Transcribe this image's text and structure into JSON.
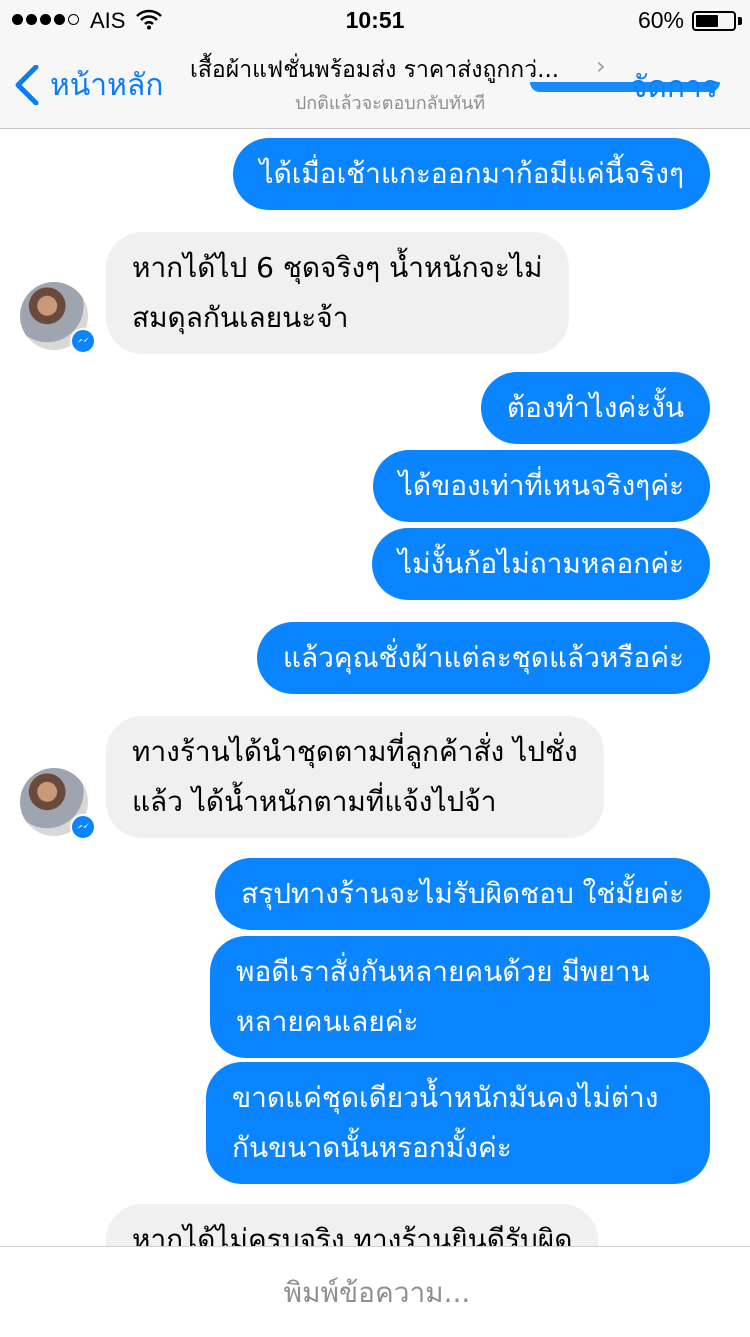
{
  "status_bar": {
    "carrier": "AIS",
    "time": "10:51",
    "battery_percent_label": "60%",
    "battery_level": 0.6
  },
  "nav": {
    "back_label": "หน้าหลัก",
    "title": "เสื้อผ้าแฟชั่นพร้อมส่ง ราคาส่งถูกกว่...",
    "subtitle": "ปกติแล้วจะตอบกลับทันที",
    "manage_label": "จัดการ",
    "accent_color": "#0a84ff"
  },
  "messages": [
    {
      "dir": "out",
      "lines": [
        "ได้เมื่อเช้าแกะออกมาก้อมีแค่นี้จริงๆ"
      ]
    },
    {
      "dir": "in",
      "lines": [
        "หากได้ไป 6 ชุดจริงๆ น้ำหนักจะไม่",
        "สมดุลกันเลยนะจ้า"
      ]
    },
    {
      "dir": "out",
      "lines": [
        "ต้องทำไงค่ะงั้น"
      ]
    },
    {
      "dir": "out",
      "lines": [
        "ได้ของเท่าที่เหนจริงๆค่ะ"
      ]
    },
    {
      "dir": "out",
      "lines": [
        "ไม่งั้นก้อไม่ถามหลอกค่ะ"
      ]
    },
    {
      "dir": "out",
      "lines": [
        "แล้วคุณชั่งผ้าแต่ละชุดแล้วหรือค่ะ"
      ]
    },
    {
      "dir": "in",
      "lines": [
        "ทางร้านได้นำชุดตามที่ลูกค้าสั่ง ไปชั่ง",
        "แล้ว ได้น้ำหนักตามที่แจ้งไปจ้า"
      ]
    },
    {
      "dir": "out",
      "lines": [
        "สรุปทางร้านจะไม่รับผิดชอบ ใช่มั้ยค่ะ"
      ]
    },
    {
      "dir": "out",
      "lines": [
        "พอดีเราสั่งกันหลายคนด้วย มีพยาน",
        "หลายคนเลยค่ะ"
      ]
    },
    {
      "dir": "out",
      "lines": [
        "ขาดแค่ชุดเดียวน้ำหนักมันคงไม่ต่าง",
        "กันขนาดนั้นหรอกมั้งค่ะ"
      ]
    },
    {
      "dir": "in",
      "lines": [
        "หากได้ไม่ครบจริง ทางร้านยินดีรับผิด"
      ]
    }
  ],
  "input": {
    "placeholder": "พิมพ์ข้อความ..."
  }
}
